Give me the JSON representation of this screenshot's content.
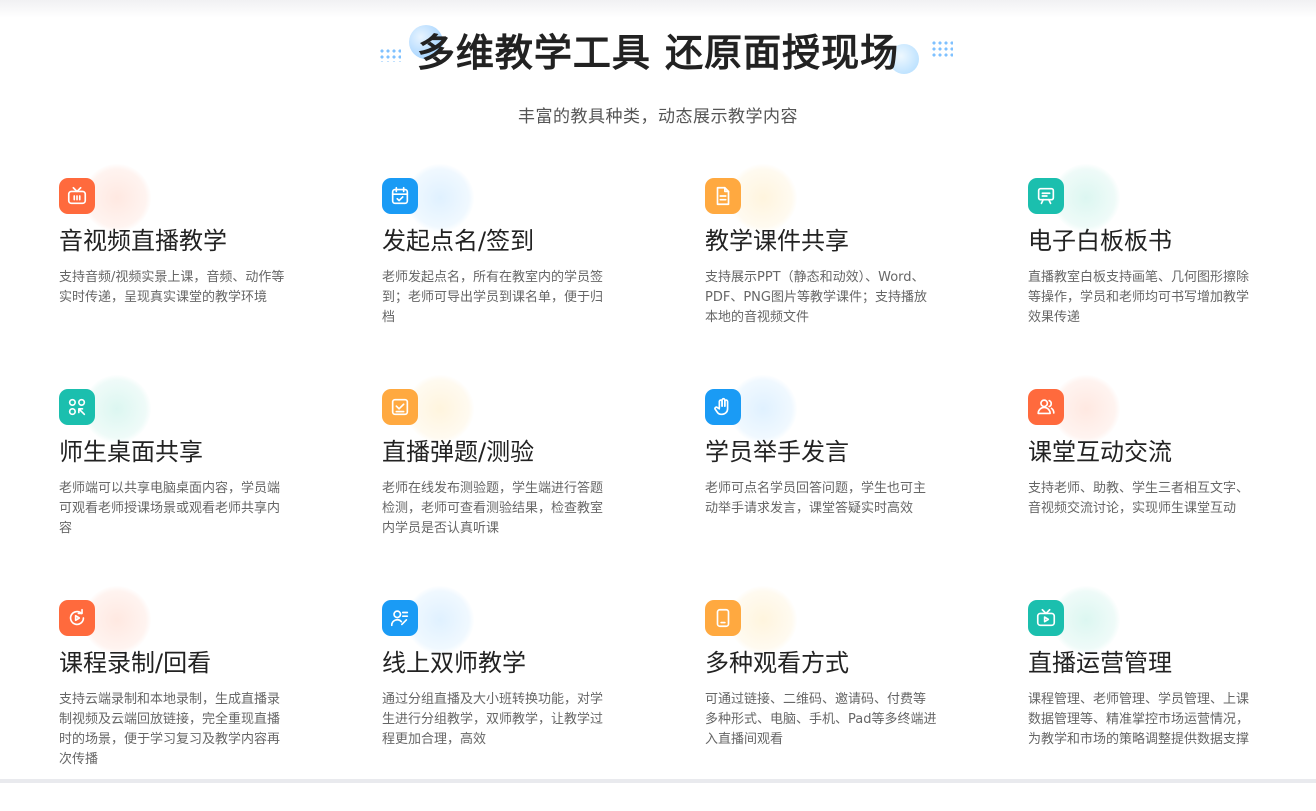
{
  "header": {
    "title": "多维教学工具 还原面授现场",
    "subtitle": "丰富的教具种类，动态展示教学内容"
  },
  "colors": {
    "orange": "#ff6a3d",
    "blue": "#1a9bf5",
    "amber": "#ffa940",
    "teal": "#1bbfae"
  },
  "features": [
    {
      "title": "音视频直播教学",
      "desc": "支持音频/视频实景上课，音频、动作等实时传递，呈现真实课堂的教学环境",
      "icon": "tv-icon",
      "color": "orange"
    },
    {
      "title": "发起点名/签到",
      "desc": "老师发起点名，所有在教室内的学员签到；老师可导出学员到课名单，便于归档",
      "icon": "calendar-check-icon",
      "color": "blue"
    },
    {
      "title": "教学课件共享",
      "desc": "支持展示PPT（静态和动效）、Word、PDF、PNG图片等教学课件；支持播放本地的音视频文件",
      "icon": "document-icon",
      "color": "amber"
    },
    {
      "title": "电子白板板书",
      "desc": "直播教室白板支持画笔、几何图形擦除等操作，学员和老师均可书写增加教学效果传递",
      "icon": "whiteboard-icon",
      "color": "teal"
    },
    {
      "title": "师生桌面共享",
      "desc": "老师端可以共享电脑桌面内容，学员端可观看老师授课场景或观看老师共享内容",
      "icon": "screen-share-icon",
      "color": "teal"
    },
    {
      "title": "直播弹题/测验",
      "desc": "老师在线发布测验题，学生端进行答题检测，老师可查看测验结果，检查教室内学员是否认真听课",
      "icon": "quiz-icon",
      "color": "amber"
    },
    {
      "title": "学员举手发言",
      "desc": "老师可点名学员回答问题，学生也可主动举手请求发言，课堂答疑实时高效",
      "icon": "raise-hand-icon",
      "color": "blue"
    },
    {
      "title": "课堂互动交流",
      "desc": "支持老师、助教、学生三者相互文字、音视频交流讨论，实现师生课堂互动",
      "icon": "users-icon",
      "color": "orange"
    },
    {
      "title": "课程录制/回看",
      "desc": "支持云端录制和本地录制，生成直播录制视频及云端回放链接，完全重现直播时的场景，便于学习复习及教学内容再次传播",
      "icon": "replay-icon",
      "color": "orange"
    },
    {
      "title": "线上双师教学",
      "desc": "通过分组直播及大小班转换功能，对学生进行分组教学，双师教学，让教学过程更加合理，高效",
      "icon": "teacher-icon",
      "color": "blue"
    },
    {
      "title": "多种观看方式",
      "desc": "可通过链接、二维码、邀请码、付费等多种形式、电脑、手机、Pad等多终端进入直播间观看",
      "icon": "mobile-icon",
      "color": "amber"
    },
    {
      "title": "直播运营管理",
      "desc": "课程管理、老师管理、学员管理、上课数据管理等、精准掌控市场运营情况，为教学和市场的策略调整提供数据支撑",
      "icon": "live-tv-icon",
      "color": "teal"
    }
  ]
}
